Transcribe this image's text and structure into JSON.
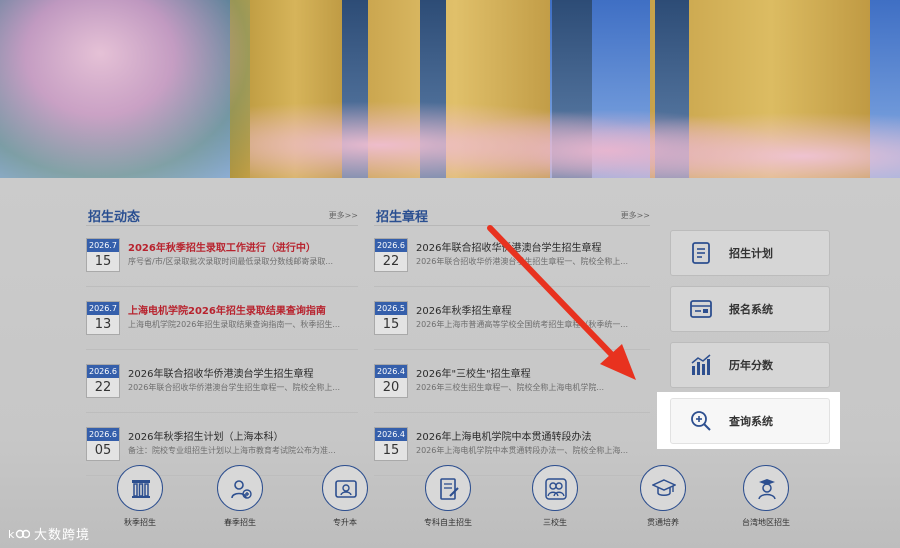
{
  "news": {
    "title": "招生动态",
    "more": "更多>>",
    "items": [
      {
        "ym": "2026.7",
        "day": "15",
        "title": "2026年秋季招生录取工作进行（进行中）",
        "summary": "序号省/市/区录取批次录取时间最低录取分数线邮寄录取...",
        "highlight": true
      },
      {
        "ym": "2026.7",
        "day": "13",
        "title": "上海电机学院2026年招生录取结果查询指南",
        "summary": "上海电机学院2026年招生录取结果查询指南一、秋季招生...",
        "highlight": true
      },
      {
        "ym": "2026.6",
        "day": "22",
        "title": "2026年联合招收华侨港澳台学生招生章程",
        "summary": "2026年联合招收华侨港澳台学生招生章程一、院校全称上...",
        "highlight": false
      },
      {
        "ym": "2026.6",
        "day": "05",
        "title": "2026年秋季招生计划（上海本科）",
        "summary": "备注：院校专业组招生计划以上海市教育考试院公布为准...",
        "highlight": false
      }
    ]
  },
  "rules": {
    "title": "招生章程",
    "more": "更多>>",
    "items": [
      {
        "ym": "2026.6",
        "day": "22",
        "title": "2026年联合招收华侨港澳台学生招生章程",
        "summary": "2026年联合招收华侨港澳台学生招生章程一、院校全称上..."
      },
      {
        "ym": "2026.5",
        "day": "15",
        "title": "2026年秋季招生章程",
        "summary": "2026年上海市普通高等学校全国统考招生章程（秋季统一..."
      },
      {
        "ym": "2026.4",
        "day": "20",
        "title": "2026年\"三校生\"招生章程",
        "summary": "2026年三校生招生章程一、院校全称上海电机学院..."
      },
      {
        "ym": "2026.4",
        "day": "15",
        "title": "2026年上海电机学院中本贯通转段办法",
        "summary": "2026年上海电机学院中本贯通转段办法一、院校全称上海..."
      }
    ]
  },
  "side_buttons": [
    {
      "label": "招生计划",
      "icon": "plan-document-icon"
    },
    {
      "label": "报名系统",
      "icon": "registration-card-icon"
    },
    {
      "label": "历年分数",
      "icon": "bar-chart-icon"
    },
    {
      "label": "查询系统",
      "icon": "magnifier-plus-icon"
    }
  ],
  "categories": [
    {
      "label": "秋季招生",
      "icon": "pillar-building-icon"
    },
    {
      "label": "春季招生",
      "icon": "person-add-icon"
    },
    {
      "label": "专升本",
      "icon": "id-card-icon"
    },
    {
      "label": "专科自主招生",
      "icon": "document-edit-icon"
    },
    {
      "label": "三校生",
      "icon": "students-group-icon"
    },
    {
      "label": "贯通培养",
      "icon": "graduation-cap-icon"
    },
    {
      "label": "台湾地区招生",
      "icon": "graduate-person-icon"
    }
  ],
  "watermark": {
    "text": "大数跨境",
    "logo": "k100-logo"
  },
  "colors": {
    "accent": "#2a4f91",
    "highlight_red": "#b8232e",
    "arrow": "#e8321f"
  }
}
